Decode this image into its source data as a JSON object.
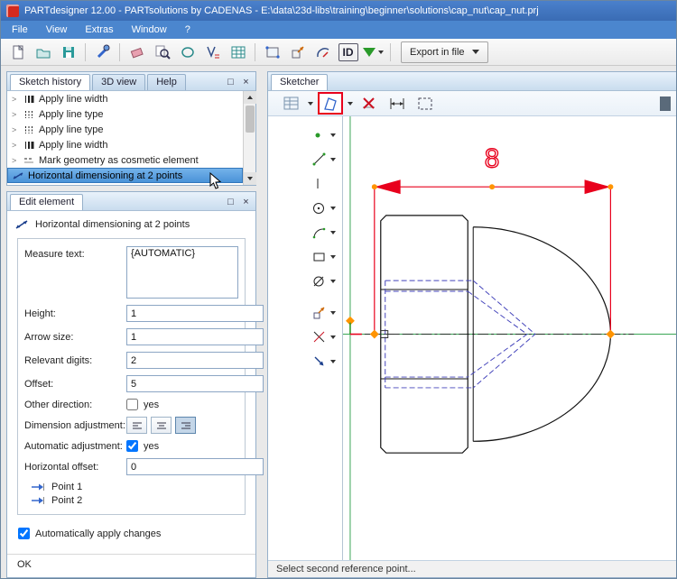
{
  "window": {
    "title": "PARTdesigner 12.00 - PARTsolutions by CADENAS - E:\\data\\23d-libs\\training\\beginner\\solutions\\cap_nut\\cap_nut.prj"
  },
  "menu": {
    "items": [
      "File",
      "View",
      "Extras",
      "Window",
      "?"
    ]
  },
  "toolbar": {
    "id_label": "ID",
    "export_label": "Export in file"
  },
  "panels": {
    "float_icon": "□",
    "close_icon": "×"
  },
  "sketch_history": {
    "tabs": [
      "Sketch history",
      "3D view",
      "Help"
    ],
    "expander": ">",
    "items": [
      "Apply line width",
      "Apply line type",
      "Apply line type",
      "Apply line width",
      "Mark geometry as cosmetic element",
      "Horizontal dimensioning at 2 points"
    ]
  },
  "edit_element": {
    "tab": "Edit element",
    "title": "Horizontal dimensioning at 2 points",
    "measure_text": {
      "label": "Measure text:",
      "value": "{AUTOMATIC}"
    },
    "height": {
      "label": "Height:",
      "value": "1"
    },
    "arrow_size": {
      "label": "Arrow size:",
      "value": "1"
    },
    "relevant_digits": {
      "label": "Relevant digits:",
      "value": "2"
    },
    "offset": {
      "label": "Offset:",
      "value": "5"
    },
    "other_direction": {
      "label": "Other direction:",
      "yes": "yes"
    },
    "dimension_adjustment": {
      "label": "Dimension adjustment:"
    },
    "automatic_adjustment": {
      "label": "Automatic adjustment:",
      "yes": "yes"
    },
    "horizontal_offset": {
      "label": "Horizontal offset:",
      "value": "0"
    },
    "point1": "Point 1",
    "point2": "Point 2",
    "apply": "Automatically apply changes",
    "ok": "OK"
  },
  "sketcher": {
    "tab": "Sketcher",
    "status": "Select second reference point...",
    "dim_value": "8"
  },
  "colors": {
    "dimension_red": "#e8001c",
    "axis_green": "#3aa655",
    "point_orange": "#ff9400",
    "hidden_blue": "#4444bb",
    "titlebar_blue": "#3a6cb4"
  }
}
